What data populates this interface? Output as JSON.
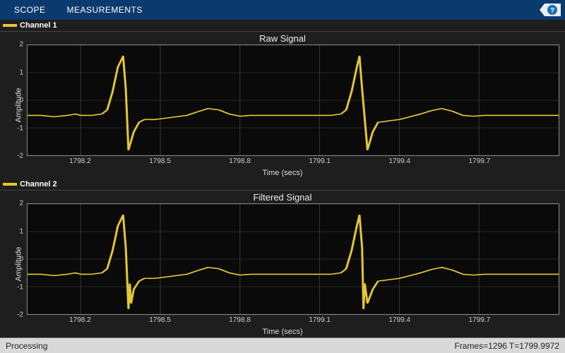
{
  "toolbar": {
    "tab_scope": "SCOPE",
    "tab_meas": "MEASUREMENTS"
  },
  "panels": [
    {
      "channel_label": "Channel 1",
      "title": "Raw Signal",
      "ylabel": "Amplitude",
      "xlabel": "Time (secs)"
    },
    {
      "channel_label": "Channel 2",
      "title": "Filtered Signal",
      "ylabel": "Amplitude",
      "xlabel": "Time (secs)"
    }
  ],
  "status": {
    "left": "Processing",
    "right": "Frames=1296  T=1799.9972"
  },
  "chart_data": [
    {
      "type": "line",
      "title": "Raw Signal",
      "xlabel": "Time (secs)",
      "ylabel": "Amplitude",
      "xlim": [
        1798.0,
        1800.0
      ],
      "ylim": [
        -2,
        2
      ],
      "xticks": [
        1798.2,
        1798.5,
        1798.8,
        1799.1,
        1799.4,
        1799.7
      ],
      "yticks": [
        -2,
        -1,
        0,
        1,
        2
      ],
      "series": [
        {
          "name": "Channel 1",
          "color": "#e6c72e",
          "x": [
            1798.0,
            1798.05,
            1798.1,
            1798.15,
            1798.18,
            1798.2,
            1798.24,
            1798.28,
            1798.3,
            1798.32,
            1798.34,
            1798.36,
            1798.37,
            1798.38,
            1798.4,
            1798.42,
            1798.44,
            1798.48,
            1798.52,
            1798.56,
            1798.6,
            1798.64,
            1798.68,
            1798.72,
            1798.76,
            1798.8,
            1798.84,
            1798.88,
            1798.92,
            1798.96,
            1799.0,
            1799.05,
            1799.1,
            1799.14,
            1799.18,
            1799.2,
            1799.22,
            1799.24,
            1799.25,
            1799.26,
            1799.28,
            1799.3,
            1799.32,
            1799.36,
            1799.4,
            1799.44,
            1799.48,
            1799.52,
            1799.56,
            1799.6,
            1799.64,
            1799.68,
            1799.72,
            1799.76,
            1799.8,
            1799.85,
            1799.9,
            1799.95,
            1800.0
          ],
          "y": [
            -0.55,
            -0.55,
            -0.6,
            -0.55,
            -0.5,
            -0.55,
            -0.55,
            -0.5,
            -0.35,
            0.3,
            1.2,
            1.6,
            0.4,
            -1.8,
            -1.15,
            -0.8,
            -0.7,
            -0.7,
            -0.65,
            -0.6,
            -0.55,
            -0.42,
            -0.3,
            -0.35,
            -0.5,
            -0.58,
            -0.55,
            -0.55,
            -0.55,
            -0.55,
            -0.55,
            -0.55,
            -0.55,
            -0.55,
            -0.5,
            -0.35,
            0.3,
            1.2,
            1.6,
            0.4,
            -1.8,
            -1.15,
            -0.8,
            -0.75,
            -0.7,
            -0.6,
            -0.5,
            -0.38,
            -0.3,
            -0.4,
            -0.55,
            -0.58,
            -0.55,
            -0.55,
            -0.55,
            -0.55,
            -0.55,
            -0.55,
            -0.55
          ]
        }
      ]
    },
    {
      "type": "line",
      "title": "Filtered Signal",
      "xlabel": "Time (secs)",
      "ylabel": "Amplitude",
      "xlim": [
        1798.0,
        1800.0
      ],
      "ylim": [
        -2,
        2
      ],
      "xticks": [
        1798.2,
        1798.5,
        1798.8,
        1799.1,
        1799.4,
        1799.7
      ],
      "yticks": [
        -2,
        -1,
        0,
        1,
        2
      ],
      "series": [
        {
          "name": "Channel 2",
          "color": "#e6c72e",
          "x": [
            1798.0,
            1798.05,
            1798.1,
            1798.15,
            1798.18,
            1798.2,
            1798.24,
            1798.28,
            1798.3,
            1798.32,
            1798.34,
            1798.36,
            1798.37,
            1798.38,
            1798.385,
            1798.39,
            1798.4,
            1798.42,
            1798.44,
            1798.48,
            1798.52,
            1798.56,
            1798.6,
            1798.64,
            1798.68,
            1798.72,
            1798.76,
            1798.8,
            1798.84,
            1798.88,
            1798.92,
            1798.96,
            1799.0,
            1799.05,
            1799.1,
            1799.14,
            1799.18,
            1799.2,
            1799.22,
            1799.24,
            1799.25,
            1799.26,
            1799.265,
            1799.27,
            1799.28,
            1799.3,
            1799.32,
            1799.36,
            1799.4,
            1799.44,
            1799.48,
            1799.52,
            1799.56,
            1799.6,
            1799.64,
            1799.68,
            1799.72,
            1799.76,
            1799.8,
            1799.85,
            1799.9,
            1799.95,
            1800.0
          ],
          "y": [
            -0.55,
            -0.55,
            -0.6,
            -0.55,
            -0.5,
            -0.55,
            -0.55,
            -0.5,
            -0.35,
            0.3,
            1.2,
            1.6,
            0.4,
            -1.8,
            -0.9,
            -1.6,
            -1.1,
            -0.8,
            -0.7,
            -0.7,
            -0.65,
            -0.6,
            -0.55,
            -0.42,
            -0.3,
            -0.35,
            -0.5,
            -0.58,
            -0.55,
            -0.55,
            -0.55,
            -0.55,
            -0.55,
            -0.55,
            -0.55,
            -0.55,
            -0.5,
            -0.35,
            0.3,
            1.2,
            1.6,
            0.4,
            -1.8,
            -0.9,
            -1.6,
            -1.1,
            -0.8,
            -0.75,
            -0.7,
            -0.6,
            -0.5,
            -0.38,
            -0.3,
            -0.4,
            -0.55,
            -0.58,
            -0.55,
            -0.55,
            -0.55,
            -0.55,
            -0.55,
            -0.55,
            -0.55
          ]
        }
      ]
    }
  ]
}
